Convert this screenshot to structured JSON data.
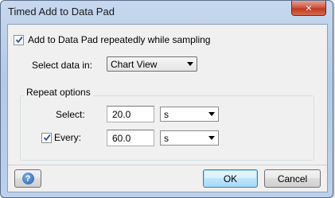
{
  "window": {
    "title": "Timed Add to Data Pad",
    "close_glyph": "✕"
  },
  "repeat_sampling": {
    "checked": true,
    "label": "Add to Data Pad repeatedly while sampling"
  },
  "select_data": {
    "label": "Select data in:",
    "value": "Chart View"
  },
  "repeat_options": {
    "group_label": "Repeat options",
    "select_label": "Select:",
    "select_value": "20.0",
    "select_unit": "s",
    "every_checked": true,
    "every_label": "Every:",
    "every_value": "60.0",
    "every_unit": "s"
  },
  "footer": {
    "help_glyph": "?",
    "ok_label": "OK",
    "cancel_label": "Cancel"
  },
  "icons": {
    "close": "close-icon",
    "help": "help-icon",
    "check": "checkmark-icon",
    "dropdown": "chevron-down-icon"
  },
  "colors": {
    "title_bar": "#b9cfe9",
    "close_button": "#c8452c",
    "checkmark": "#2a4f9c",
    "default_button_border": "#3c7fb1",
    "help_icon": "#1e5aa8"
  }
}
